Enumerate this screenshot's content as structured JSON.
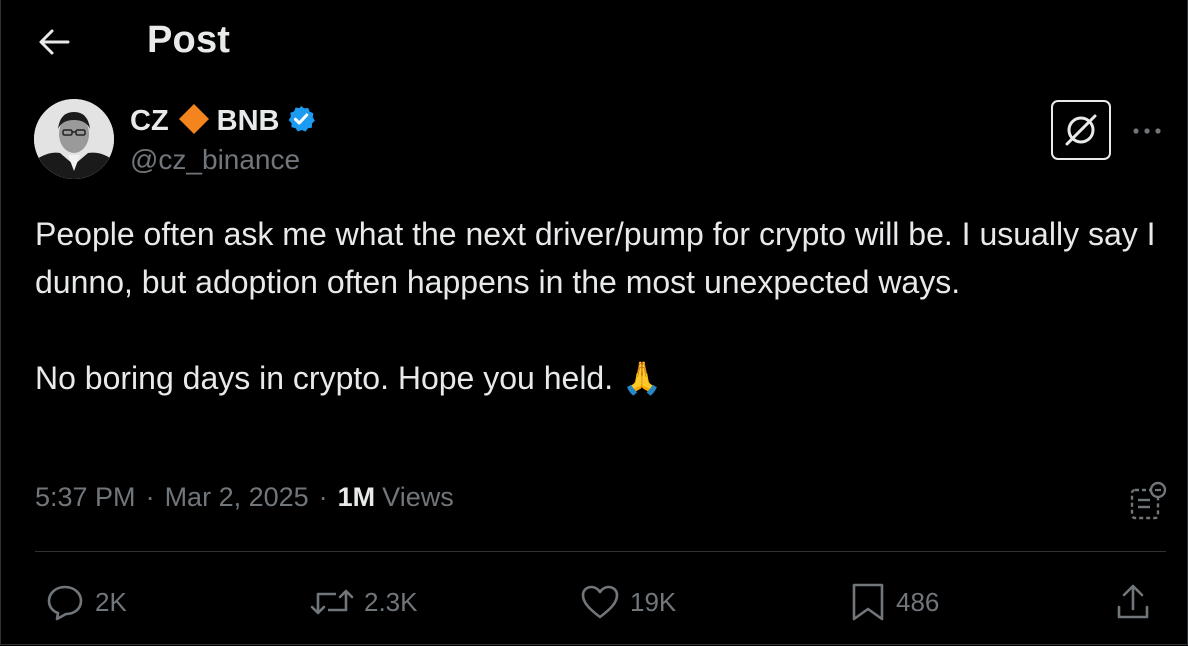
{
  "header": {
    "title": "Post",
    "back_icon": "arrow-left-icon"
  },
  "author": {
    "name_first": "CZ",
    "name_second": "BNB",
    "handle": "@cz_binance",
    "verified": true,
    "diamond_color": "#f3841e",
    "badge_color": "#1d9bf0"
  },
  "post": {
    "paragraph1": "People often ask me what the next driver/pump for crypto will be. I usually say I dunno, but adoption often happens in the most unexpected ways.",
    "paragraph2": "No boring days in crypto. Hope you held. 🙏",
    "time": "5:37 PM",
    "date": "Mar 2, 2025",
    "separator": "·",
    "views_count": "1M",
    "views_label": "Views"
  },
  "actions": {
    "replies": "2K",
    "reposts": "2.3K",
    "likes": "19K",
    "bookmarks": "486"
  },
  "colors": {
    "background": "#000000",
    "text": "#e7e9ea",
    "muted": "#71767b",
    "border": "#2f3336"
  }
}
